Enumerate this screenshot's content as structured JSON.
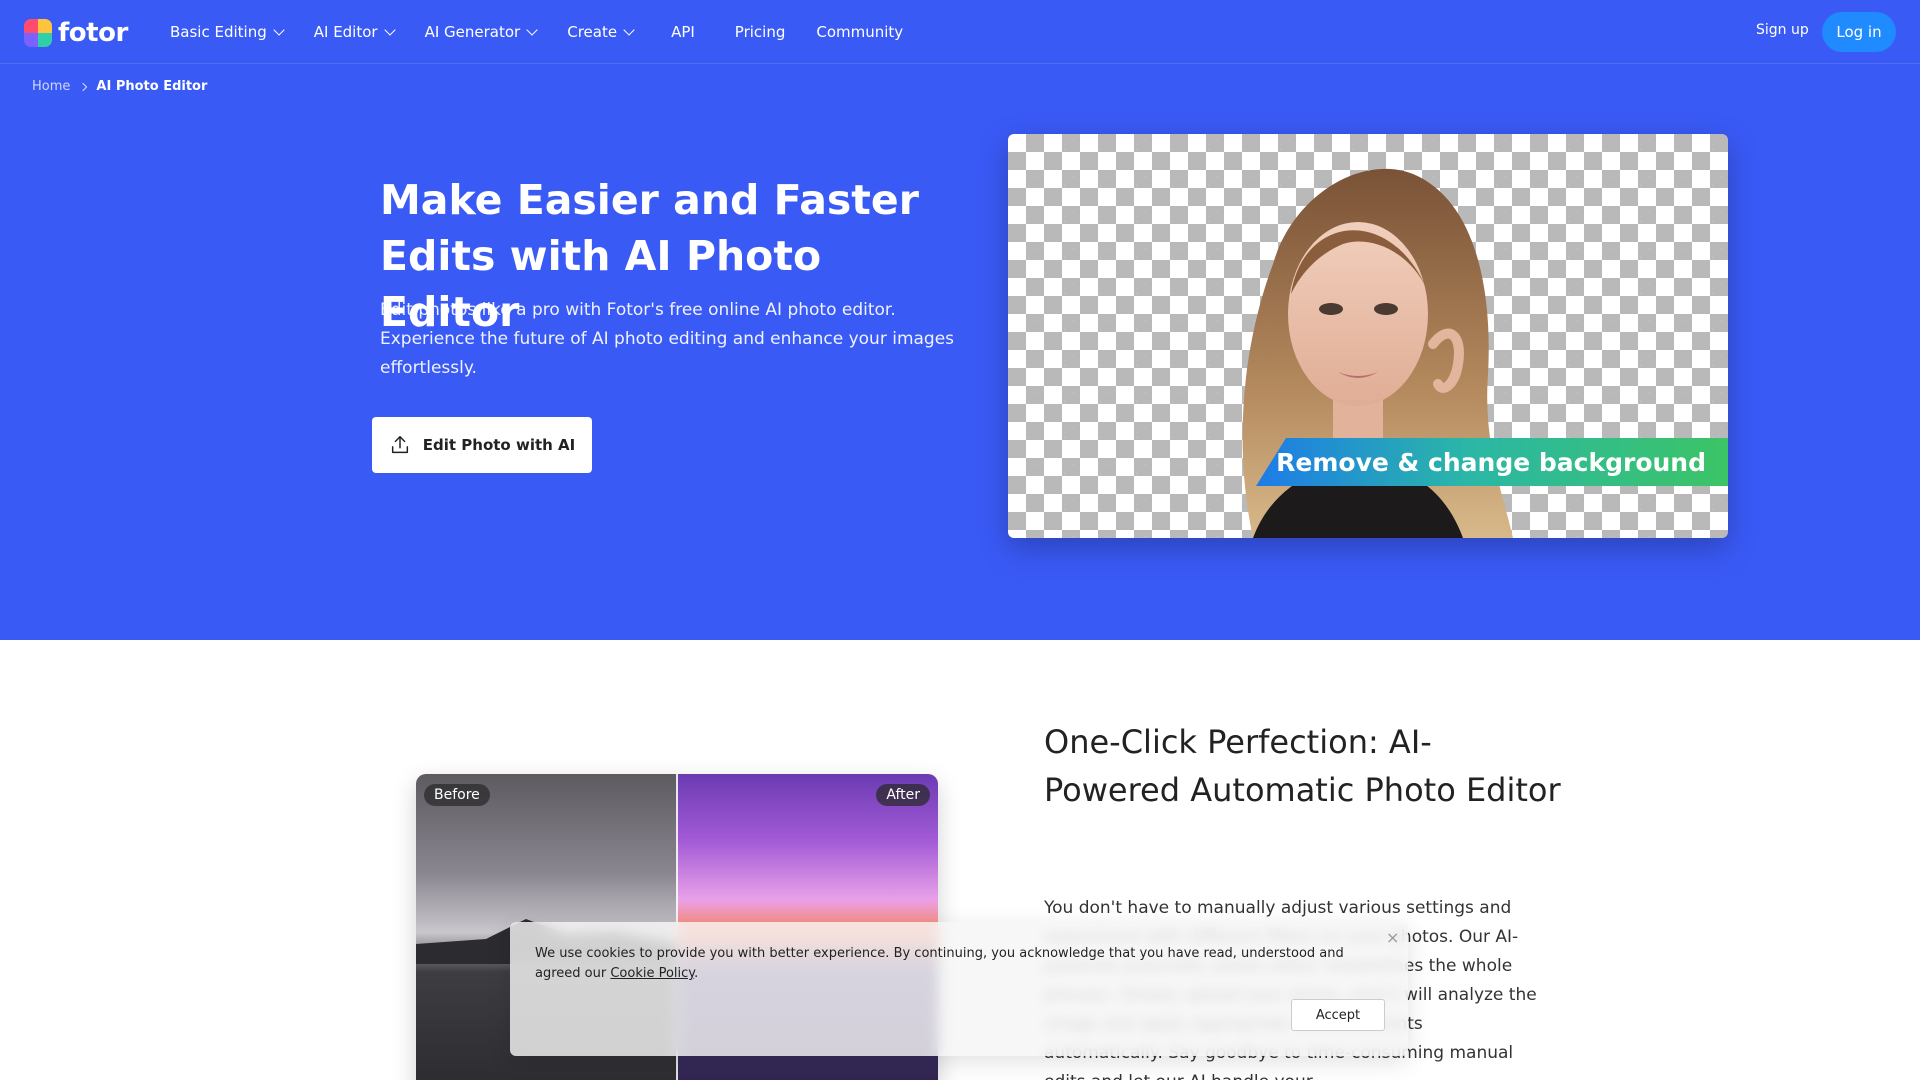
{
  "brand": {
    "name": "fotor"
  },
  "nav": {
    "items": [
      {
        "label": "Basic Editing",
        "has_dropdown": true
      },
      {
        "label": "AI Editor",
        "has_dropdown": true
      },
      {
        "label": "AI Generator",
        "has_dropdown": true
      },
      {
        "label": "Create",
        "has_dropdown": true
      },
      {
        "label": "API",
        "has_dropdown": false
      },
      {
        "label": "Pricing",
        "has_dropdown": false
      },
      {
        "label": "Community",
        "has_dropdown": false
      }
    ],
    "signup": "Sign up",
    "login": "Log in"
  },
  "breadcrumb": {
    "home": "Home",
    "current": "AI Photo Editor"
  },
  "hero": {
    "title": "Make Easier and Faster Edits with AI Photo Editor",
    "description": "Edit photos like a pro with Fotor's free online AI photo editor. Experience the future of AI photo editing and enhance your images effortlessly.",
    "cta": "Edit Photo with AI",
    "cta_icon": "upload-icon",
    "image_banner": "Remove & change background"
  },
  "section2": {
    "title": "One-Click Perfection: AI-Powered Automatic Photo Editor",
    "text": "You don't have to manually adjust various settings and experiment with different filters on your photos. Our AI-powered automatic photo editor streamlines the whole process. Simply upload your photo, and it will analyze the image and apply appropriate enhancements automatically. Say goodbye to time-consuming manual edits and let our AI handle your",
    "compare": {
      "before": "Before",
      "after": "After"
    }
  },
  "cookie": {
    "text": "We use cookies to provide you with better experience. By continuing, you acknowledge that you have read, understood and agreed our",
    "link": "Cookie Policy",
    "end": ".",
    "accept": "Accept",
    "close": "×"
  },
  "colors": {
    "brand_blue": "#3a5af6",
    "login_blue": "#1f8bff"
  }
}
